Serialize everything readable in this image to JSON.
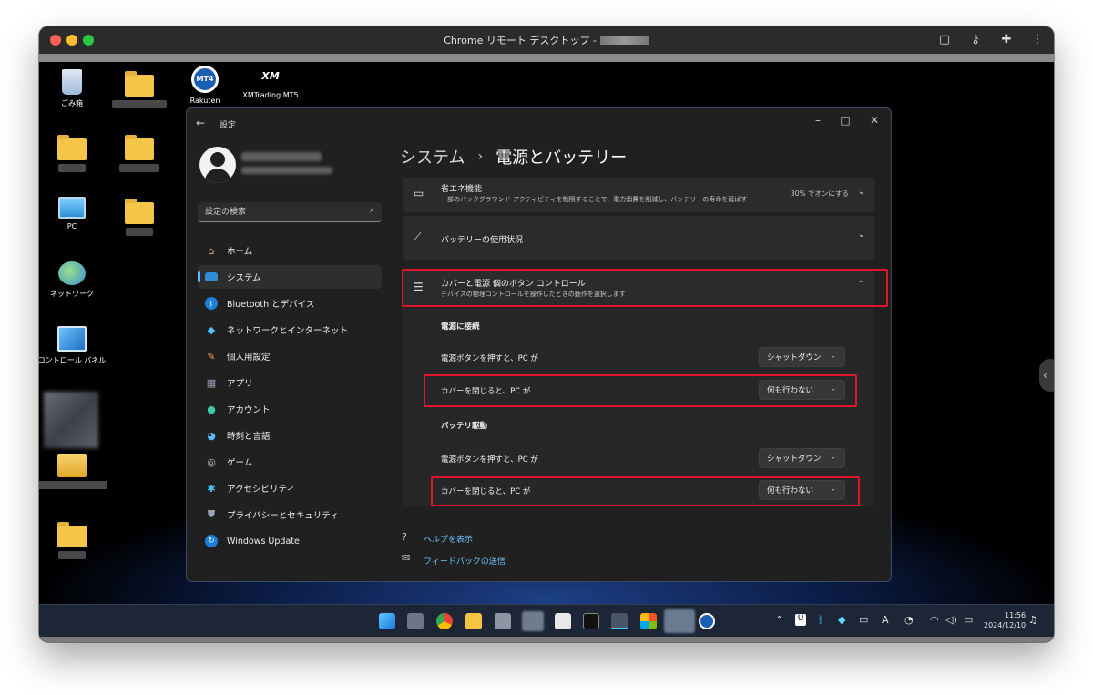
{
  "mac_window": {
    "title": "Chrome リモート デスクトップ -",
    "traffic_colors": [
      "#ff5f57",
      "#febc2e",
      "#28c840"
    ]
  },
  "desktop": {
    "icons": [
      {
        "label": "ごみ箱",
        "icon": "recycle-bin-icon"
      },
      {
        "label": "PC",
        "icon": "computer-icon"
      },
      {
        "label": "ネットワーク",
        "icon": "network-icon"
      },
      {
        "label": "コントロール パネル",
        "icon": "control-panel-icon"
      },
      {
        "label": "Rakuten",
        "icon": "mt4-icon",
        "badge": "MT4"
      },
      {
        "label": "XMTrading MT5",
        "icon": "xm-icon",
        "badge": "XM"
      }
    ]
  },
  "settings": {
    "app_title": "設定",
    "search_placeholder": "設定の検索",
    "nav": [
      {
        "label": "ホーム",
        "icon": "home-icon"
      },
      {
        "label": "システム",
        "icon": "system-icon",
        "selected": true
      },
      {
        "label": "Bluetooth とデバイス",
        "icon": "bluetooth-icon"
      },
      {
        "label": "ネットワークとインターネット",
        "icon": "wifi-icon"
      },
      {
        "label": "個人用設定",
        "icon": "brush-icon"
      },
      {
        "label": "アプリ",
        "icon": "apps-icon"
      },
      {
        "label": "アカウント",
        "icon": "account-icon"
      },
      {
        "label": "時刻と言語",
        "icon": "globe-clock-icon"
      },
      {
        "label": "ゲーム",
        "icon": "gamepad-icon"
      },
      {
        "label": "アクセシビリティ",
        "icon": "accessibility-icon"
      },
      {
        "label": "プライバシーとセキュリティ",
        "icon": "shield-icon"
      },
      {
        "label": "Windows Update",
        "icon": "update-icon"
      }
    ],
    "breadcrumb": {
      "parent": "システム",
      "separator": "›",
      "current": "電源とバッテリー"
    },
    "cards": {
      "energy_saver": {
        "title": "省エネ機能",
        "desc": "一部のバックグラウンド アクティビティを制限することで、電力消費を削減し、バッテリーの寿命を延ばす",
        "value": "30% でオンにする"
      },
      "battery_usage": {
        "title": "バッテリーの使用状況"
      },
      "lid_buttons": {
        "title": "カバーと電源 個のボタン コントロール",
        "desc": "デバイスの物理コントロールを操作したときの動作を選択します"
      }
    },
    "plugged_in": {
      "heading": "電源に接続",
      "rows": [
        {
          "label": "電源ボタンを押すと、PC が",
          "value": "シャットダウン"
        },
        {
          "label": "カバーを閉じると、PC が",
          "value": "何も行わない"
        }
      ]
    },
    "on_battery": {
      "heading": "バッテリ駆動",
      "rows": [
        {
          "label": "電源ボタンを押すと、PC が",
          "value": "シャットダウン"
        },
        {
          "label": "カバーを閉じると、PC が",
          "value": "何も行わない"
        }
      ]
    },
    "links": {
      "help": "ヘルプを表示",
      "feedback": "フィードバックの送信"
    }
  },
  "taskbar": {
    "time": "11:56",
    "date": "2024/12/10",
    "accent": "#4cc2ff"
  }
}
